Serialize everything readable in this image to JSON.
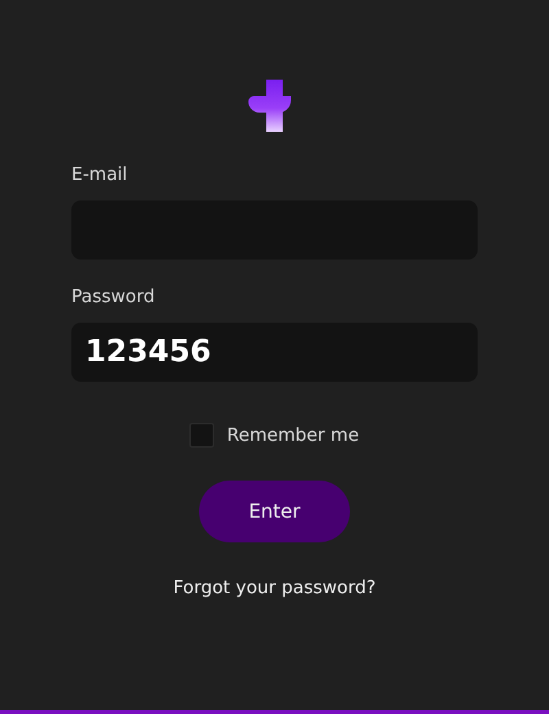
{
  "fields": [
    {
      "label": "E-mail"
    },
    {
      "label": "Password",
      "value": "123456"
    }
  ],
  "remember": {
    "label": "Remember me",
    "checked": false
  },
  "submit": {
    "label": "Enter"
  },
  "forgot": {
    "label": "Forgot your password?"
  }
}
